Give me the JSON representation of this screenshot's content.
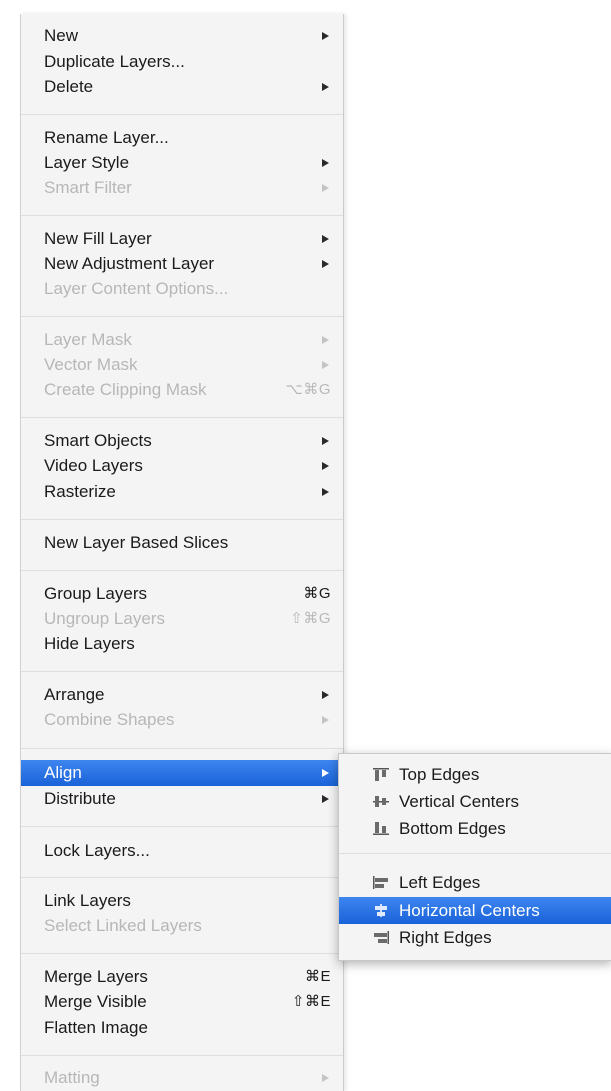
{
  "menu": {
    "items": [
      {
        "label": "New",
        "submenu": true,
        "enabled": true
      },
      {
        "label": "Duplicate Layers...",
        "enabled": true
      },
      {
        "label": "Delete",
        "submenu": true,
        "enabled": true
      },
      {
        "label": "Rename Layer...",
        "enabled": true
      },
      {
        "label": "Layer Style",
        "submenu": true,
        "enabled": true
      },
      {
        "label": "Smart Filter",
        "submenu": true,
        "enabled": false
      },
      {
        "label": "New Fill Layer",
        "submenu": true,
        "enabled": true
      },
      {
        "label": "New Adjustment Layer",
        "submenu": true,
        "enabled": true
      },
      {
        "label": "Layer Content Options...",
        "enabled": false
      },
      {
        "label": "Layer Mask",
        "submenu": true,
        "enabled": false
      },
      {
        "label": "Vector Mask",
        "submenu": true,
        "enabled": false
      },
      {
        "label": "Create Clipping Mask",
        "shortcut": "⌥⌘G",
        "enabled": false
      },
      {
        "label": "Smart Objects",
        "submenu": true,
        "enabled": true
      },
      {
        "label": "Video Layers",
        "submenu": true,
        "enabled": true
      },
      {
        "label": "Rasterize",
        "submenu": true,
        "enabled": true
      },
      {
        "label": "New Layer Based Slices",
        "enabled": true
      },
      {
        "label": "Group Layers",
        "shortcut": "⌘G",
        "enabled": true
      },
      {
        "label": "Ungroup Layers",
        "shortcut": "⇧⌘G",
        "enabled": false
      },
      {
        "label": "Hide Layers",
        "enabled": true
      },
      {
        "label": "Arrange",
        "submenu": true,
        "enabled": true
      },
      {
        "label": "Combine Shapes",
        "submenu": true,
        "enabled": false
      },
      {
        "label": "Align",
        "submenu": true,
        "enabled": true,
        "highlighted": true
      },
      {
        "label": "Distribute",
        "submenu": true,
        "enabled": true
      },
      {
        "label": "Lock Layers...",
        "enabled": true
      },
      {
        "label": "Link Layers",
        "enabled": true
      },
      {
        "label": "Select Linked Layers",
        "enabled": false
      },
      {
        "label": "Merge Layers",
        "shortcut": "⌘E",
        "enabled": true
      },
      {
        "label": "Merge Visible",
        "shortcut": "⇧⌘E",
        "enabled": true
      },
      {
        "label": "Flatten Image",
        "enabled": true
      },
      {
        "label": "Matting",
        "submenu": true,
        "enabled": false
      }
    ]
  },
  "align_submenu": {
    "items": [
      {
        "label": "Top Edges",
        "icon": "align-top-edges-icon"
      },
      {
        "label": "Vertical Centers",
        "icon": "align-vertical-centers-icon"
      },
      {
        "label": "Bottom Edges",
        "icon": "align-bottom-edges-icon"
      },
      {
        "label": "Left Edges",
        "icon": "align-left-edges-icon"
      },
      {
        "label": "Horizontal Centers",
        "icon": "align-horizontal-centers-icon",
        "highlighted": true
      },
      {
        "label": "Right Edges",
        "icon": "align-right-edges-icon"
      }
    ]
  },
  "colors": {
    "highlight": "#2a72e3",
    "menu_background": "#f4f4f4",
    "disabled_text": "#b7b7b7"
  }
}
